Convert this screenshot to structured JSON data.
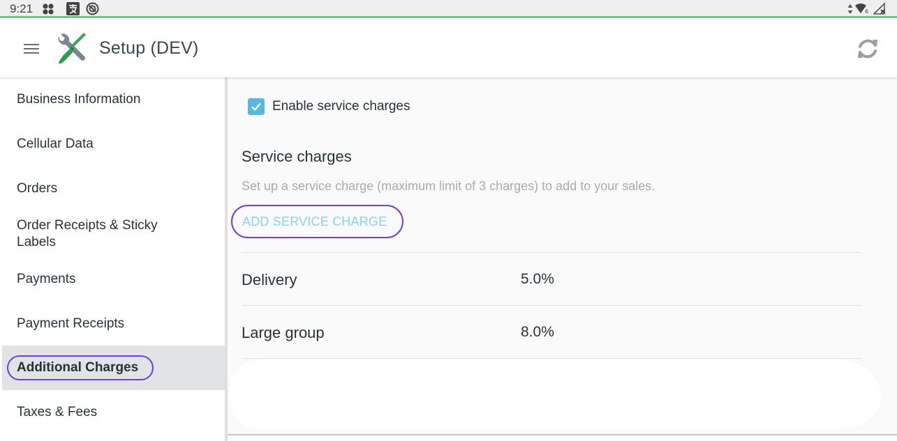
{
  "status_bar": {
    "time": "9:21",
    "left_icons": [
      "clover-icon",
      "input-method-icon",
      "vpn-icon"
    ],
    "right_icons": [
      "data-arrows-icon",
      "wifi-icon",
      "no-signal-icon"
    ]
  },
  "app_bar": {
    "title": "Setup (DEV)",
    "menu_icon": "hamburger-menu-icon",
    "logo_icon": "tools-icon",
    "action_icon": "refresh-icon"
  },
  "sidebar": {
    "items": [
      {
        "label": "Business Information",
        "active": false
      },
      {
        "label": "Cellular Data",
        "active": false
      },
      {
        "label": "Orders",
        "active": false
      },
      {
        "label": "Order Receipts & Sticky Labels",
        "active": false
      },
      {
        "label": "Payments",
        "active": false
      },
      {
        "label": "Payment Receipts",
        "active": false
      },
      {
        "label": "Additional Charges",
        "active": true
      },
      {
        "label": "Taxes & Fees",
        "active": false
      }
    ]
  },
  "content": {
    "enable_checkbox": {
      "label": "Enable service charges",
      "checked": true
    },
    "section_title": "Service charges",
    "section_description": "Set up a service charge (maximum limit of 3 charges) to add to your sales.",
    "add_button_label": "ADD SERVICE CHARGE",
    "charges": [
      {
        "name": "Delivery",
        "value": "5.0%"
      },
      {
        "name": "Large group",
        "value": "8.0%"
      }
    ]
  },
  "colors": {
    "accent": "#57b8e3",
    "add_button_text": "#84d2ee",
    "highlight_ring": "#6c3fd6",
    "status_bar_line": "#5fcf8a",
    "active_item_bg": "#e2e3e5"
  }
}
